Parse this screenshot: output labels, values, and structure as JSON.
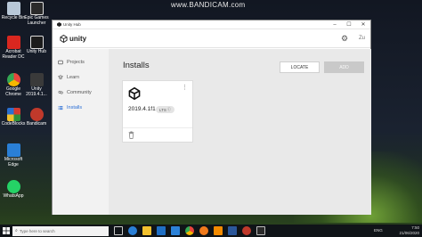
{
  "watermark": "www.BANDICAM.com",
  "desktop_icons": [
    {
      "label": "Recycle Bin",
      "icon": "recycle-bin-icon",
      "color": "#b8c8d8"
    },
    {
      "label": "Epic Games Launcher",
      "icon": "epic-games-icon",
      "color": "#2b2b2b"
    },
    {
      "label": "Acrobat Reader DC",
      "icon": "acrobat-icon",
      "color": "#d9271f"
    },
    {
      "label": "Unity Hub",
      "icon": "unity-hub-icon",
      "color": "#1c1c1c"
    },
    {
      "label": "Google Chrome",
      "icon": "chrome-icon",
      "color": "#e8453c"
    },
    {
      "label": "Unity 2019.4.1...",
      "icon": "unity-icon",
      "color": "#3a3a3a"
    },
    {
      "label": "CodeBlocks",
      "icon": "codeblocks-icon",
      "color": "#d43a2f"
    },
    {
      "label": "Bandicam",
      "icon": "bandicam-icon",
      "color": "#c0392b"
    },
    {
      "label": "Microsoft Edge",
      "icon": "edge-icon",
      "color": "#2a7fd6"
    },
    {
      "label": "WhatsApp",
      "icon": "whatsapp-icon",
      "color": "#25d366"
    }
  ],
  "window": {
    "title": "Unity Hub",
    "controls": {
      "minimize": "–",
      "maximize": "☐",
      "close": "✕"
    }
  },
  "header": {
    "logo_text": "unity",
    "user_initials": "Zu"
  },
  "sidebar": {
    "items": [
      {
        "label": "Projects",
        "icon": "projects-icon",
        "active": false
      },
      {
        "label": "Learn",
        "icon": "learn-icon",
        "active": false
      },
      {
        "label": "Community",
        "icon": "community-icon",
        "active": false
      },
      {
        "label": "Installs",
        "icon": "installs-icon",
        "active": true
      }
    ]
  },
  "main": {
    "title": "Installs",
    "locate_label": "LOCATE",
    "add_label": "ADD",
    "install": {
      "version": "2019.4.1f1",
      "badge": "LTS"
    }
  },
  "taskbar": {
    "search_placeholder": "Type here to search",
    "pinned": [
      "task-view-icon",
      "edge-icon",
      "file-explorer-icon",
      "store-icon",
      "mail-icon",
      "chrome-icon",
      "firefox-icon",
      "vlc-icon",
      "word-icon",
      "bandicam-icon",
      "unity-hub-icon"
    ],
    "time": "7:50",
    "date": "21/06/2020",
    "lang": "ENG"
  },
  "colors": {
    "accent": "#2b6fd6",
    "taskbar": "#101418"
  }
}
